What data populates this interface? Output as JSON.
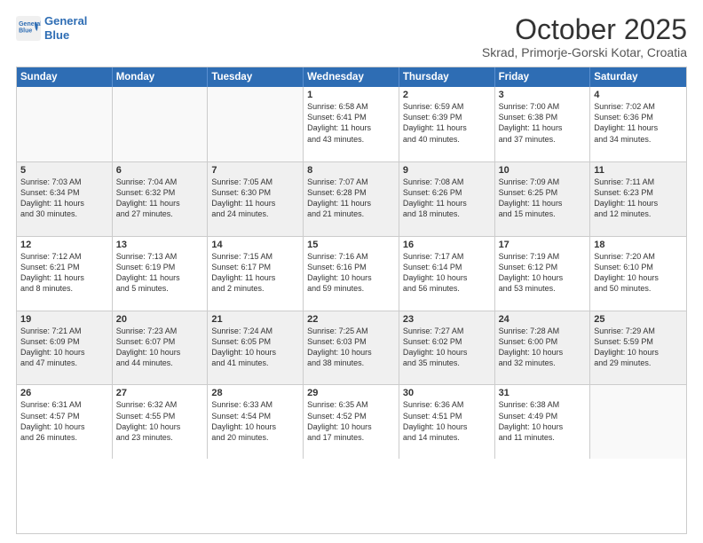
{
  "logo": {
    "line1": "General",
    "line2": "Blue"
  },
  "title": "October 2025",
  "subtitle": "Skrad, Primorje-Gorski Kotar, Croatia",
  "header_days": [
    "Sunday",
    "Monday",
    "Tuesday",
    "Wednesday",
    "Thursday",
    "Friday",
    "Saturday"
  ],
  "rows": [
    [
      {
        "day": "",
        "info": [],
        "empty": true
      },
      {
        "day": "",
        "info": [],
        "empty": true
      },
      {
        "day": "",
        "info": [],
        "empty": true
      },
      {
        "day": "1",
        "info": [
          "Sunrise: 6:58 AM",
          "Sunset: 6:41 PM",
          "Daylight: 11 hours",
          "and 43 minutes."
        ]
      },
      {
        "day": "2",
        "info": [
          "Sunrise: 6:59 AM",
          "Sunset: 6:39 PM",
          "Daylight: 11 hours",
          "and 40 minutes."
        ]
      },
      {
        "day": "3",
        "info": [
          "Sunrise: 7:00 AM",
          "Sunset: 6:38 PM",
          "Daylight: 11 hours",
          "and 37 minutes."
        ]
      },
      {
        "day": "4",
        "info": [
          "Sunrise: 7:02 AM",
          "Sunset: 6:36 PM",
          "Daylight: 11 hours",
          "and 34 minutes."
        ]
      }
    ],
    [
      {
        "day": "5",
        "info": [
          "Sunrise: 7:03 AM",
          "Sunset: 6:34 PM",
          "Daylight: 11 hours",
          "and 30 minutes."
        ],
        "shaded": true
      },
      {
        "day": "6",
        "info": [
          "Sunrise: 7:04 AM",
          "Sunset: 6:32 PM",
          "Daylight: 11 hours",
          "and 27 minutes."
        ],
        "shaded": true
      },
      {
        "day": "7",
        "info": [
          "Sunrise: 7:05 AM",
          "Sunset: 6:30 PM",
          "Daylight: 11 hours",
          "and 24 minutes."
        ],
        "shaded": true
      },
      {
        "day": "8",
        "info": [
          "Sunrise: 7:07 AM",
          "Sunset: 6:28 PM",
          "Daylight: 11 hours",
          "and 21 minutes."
        ],
        "shaded": true
      },
      {
        "day": "9",
        "info": [
          "Sunrise: 7:08 AM",
          "Sunset: 6:26 PM",
          "Daylight: 11 hours",
          "and 18 minutes."
        ],
        "shaded": true
      },
      {
        "day": "10",
        "info": [
          "Sunrise: 7:09 AM",
          "Sunset: 6:25 PM",
          "Daylight: 11 hours",
          "and 15 minutes."
        ],
        "shaded": true
      },
      {
        "day": "11",
        "info": [
          "Sunrise: 7:11 AM",
          "Sunset: 6:23 PM",
          "Daylight: 11 hours",
          "and 12 minutes."
        ],
        "shaded": true
      }
    ],
    [
      {
        "day": "12",
        "info": [
          "Sunrise: 7:12 AM",
          "Sunset: 6:21 PM",
          "Daylight: 11 hours",
          "and 8 minutes."
        ]
      },
      {
        "day": "13",
        "info": [
          "Sunrise: 7:13 AM",
          "Sunset: 6:19 PM",
          "Daylight: 11 hours",
          "and 5 minutes."
        ]
      },
      {
        "day": "14",
        "info": [
          "Sunrise: 7:15 AM",
          "Sunset: 6:17 PM",
          "Daylight: 11 hours",
          "and 2 minutes."
        ]
      },
      {
        "day": "15",
        "info": [
          "Sunrise: 7:16 AM",
          "Sunset: 6:16 PM",
          "Daylight: 10 hours",
          "and 59 minutes."
        ]
      },
      {
        "day": "16",
        "info": [
          "Sunrise: 7:17 AM",
          "Sunset: 6:14 PM",
          "Daylight: 10 hours",
          "and 56 minutes."
        ]
      },
      {
        "day": "17",
        "info": [
          "Sunrise: 7:19 AM",
          "Sunset: 6:12 PM",
          "Daylight: 10 hours",
          "and 53 minutes."
        ]
      },
      {
        "day": "18",
        "info": [
          "Sunrise: 7:20 AM",
          "Sunset: 6:10 PM",
          "Daylight: 10 hours",
          "and 50 minutes."
        ]
      }
    ],
    [
      {
        "day": "19",
        "info": [
          "Sunrise: 7:21 AM",
          "Sunset: 6:09 PM",
          "Daylight: 10 hours",
          "and 47 minutes."
        ],
        "shaded": true
      },
      {
        "day": "20",
        "info": [
          "Sunrise: 7:23 AM",
          "Sunset: 6:07 PM",
          "Daylight: 10 hours",
          "and 44 minutes."
        ],
        "shaded": true
      },
      {
        "day": "21",
        "info": [
          "Sunrise: 7:24 AM",
          "Sunset: 6:05 PM",
          "Daylight: 10 hours",
          "and 41 minutes."
        ],
        "shaded": true
      },
      {
        "day": "22",
        "info": [
          "Sunrise: 7:25 AM",
          "Sunset: 6:03 PM",
          "Daylight: 10 hours",
          "and 38 minutes."
        ],
        "shaded": true
      },
      {
        "day": "23",
        "info": [
          "Sunrise: 7:27 AM",
          "Sunset: 6:02 PM",
          "Daylight: 10 hours",
          "and 35 minutes."
        ],
        "shaded": true
      },
      {
        "day": "24",
        "info": [
          "Sunrise: 7:28 AM",
          "Sunset: 6:00 PM",
          "Daylight: 10 hours",
          "and 32 minutes."
        ],
        "shaded": true
      },
      {
        "day": "25",
        "info": [
          "Sunrise: 7:29 AM",
          "Sunset: 5:59 PM",
          "Daylight: 10 hours",
          "and 29 minutes."
        ],
        "shaded": true
      }
    ],
    [
      {
        "day": "26",
        "info": [
          "Sunrise: 6:31 AM",
          "Sunset: 4:57 PM",
          "Daylight: 10 hours",
          "and 26 minutes."
        ]
      },
      {
        "day": "27",
        "info": [
          "Sunrise: 6:32 AM",
          "Sunset: 4:55 PM",
          "Daylight: 10 hours",
          "and 23 minutes."
        ]
      },
      {
        "day": "28",
        "info": [
          "Sunrise: 6:33 AM",
          "Sunset: 4:54 PM",
          "Daylight: 10 hours",
          "and 20 minutes."
        ]
      },
      {
        "day": "29",
        "info": [
          "Sunrise: 6:35 AM",
          "Sunset: 4:52 PM",
          "Daylight: 10 hours",
          "and 17 minutes."
        ]
      },
      {
        "day": "30",
        "info": [
          "Sunrise: 6:36 AM",
          "Sunset: 4:51 PM",
          "Daylight: 10 hours",
          "and 14 minutes."
        ]
      },
      {
        "day": "31",
        "info": [
          "Sunrise: 6:38 AM",
          "Sunset: 4:49 PM",
          "Daylight: 10 hours",
          "and 11 minutes."
        ]
      },
      {
        "day": "",
        "info": [],
        "empty": true
      }
    ]
  ]
}
